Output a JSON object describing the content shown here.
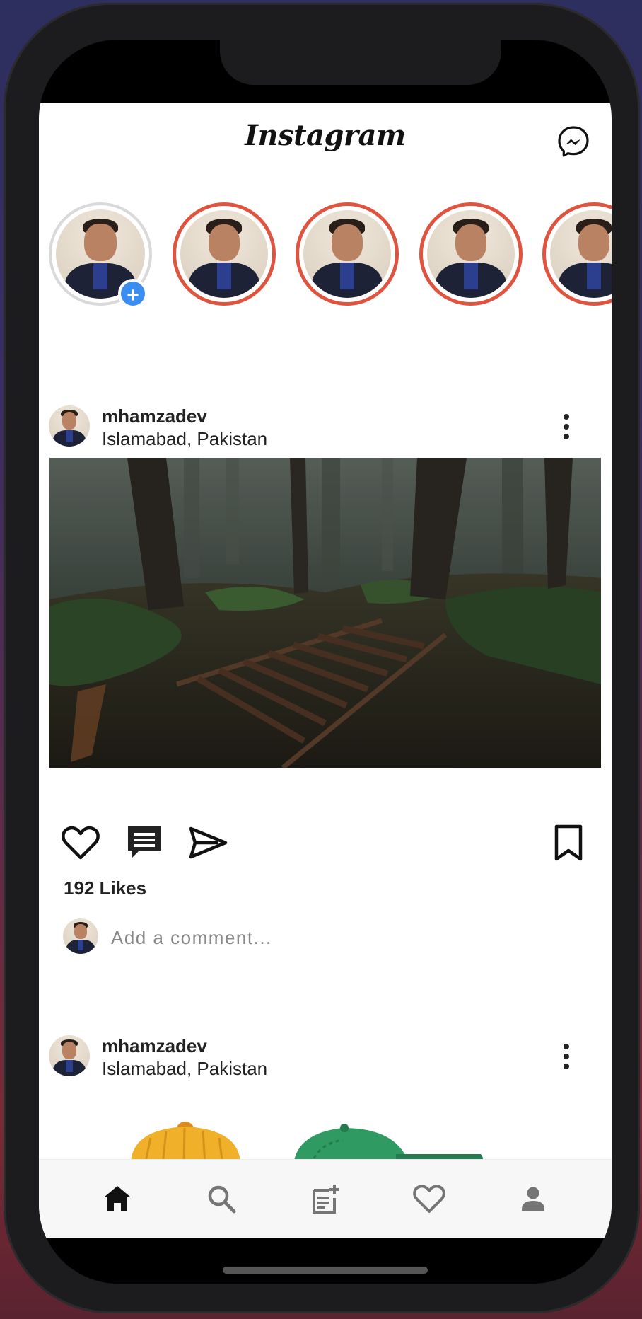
{
  "app": {
    "title": "Instagram",
    "messenger_icon": "messenger-icon"
  },
  "stories": {
    "items": [
      {
        "kind": "own",
        "has_add_badge": true,
        "add_glyph": "+"
      },
      {
        "kind": "unseen"
      },
      {
        "kind": "unseen"
      },
      {
        "kind": "unseen"
      },
      {
        "kind": "unseen"
      }
    ]
  },
  "posts": [
    {
      "username": "mhamzadev",
      "location": "Islamabad, Pakistan",
      "more_icon": "more-vertical-icon",
      "likes": "192 Likes",
      "comment_placeholder": "Add a comment..."
    },
    {
      "username": "mhamzadev",
      "location": "Islamabad, Pakistan",
      "more_icon": "more-vertical-icon"
    }
  ],
  "actions": {
    "like_icon": "heart-icon",
    "comment_icon": "comment-icon",
    "share_icon": "send-icon",
    "save_icon": "bookmark-icon"
  },
  "bottom_nav": {
    "items": [
      {
        "icon": "home-icon",
        "active": true
      },
      {
        "icon": "search-icon",
        "active": false
      },
      {
        "icon": "new-post-icon",
        "active": false
      },
      {
        "icon": "heart-icon",
        "active": false
      },
      {
        "icon": "profile-icon",
        "active": false
      }
    ]
  },
  "colors": {
    "story_ring": "#e0533f",
    "add_badge": "#3b8ef0",
    "nav_active": "#111111",
    "nav_inactive": "#757575"
  }
}
